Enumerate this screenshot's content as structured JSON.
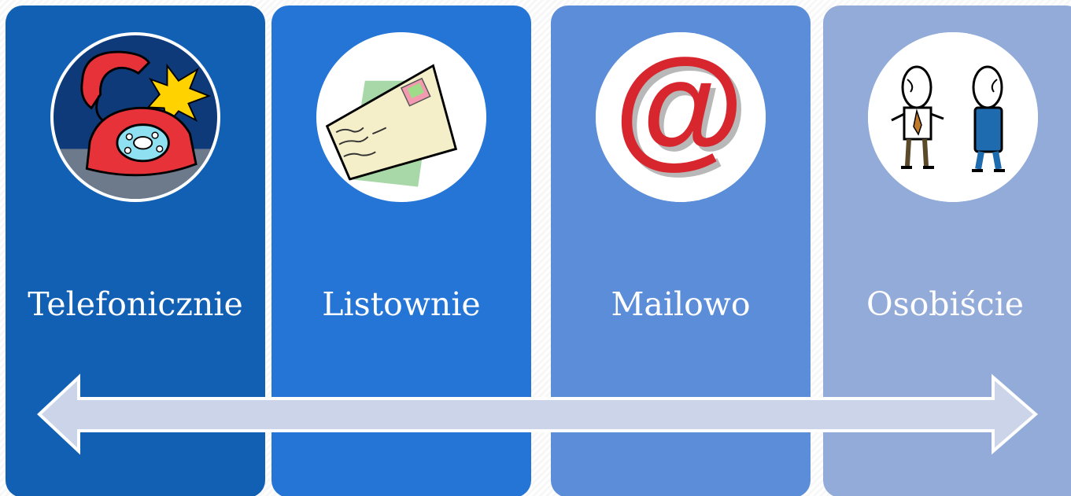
{
  "channels": [
    {
      "label": "Telefonicznie",
      "icon": "telephone-icon",
      "color": "#1160b4"
    },
    {
      "label": "Listownie",
      "icon": "letter-icon",
      "color": "#2475d6"
    },
    {
      "label": "Mailowo",
      "icon": "at-sign-icon",
      "color": "#5b8dd8"
    },
    {
      "label": "Osobiście",
      "icon": "people-talking-icon",
      "color": "#93abd9"
    }
  ],
  "arrow": {
    "type": "double-headed",
    "fill": "#cbd4e8",
    "stroke": "#ffffff"
  },
  "at_symbol": "@"
}
